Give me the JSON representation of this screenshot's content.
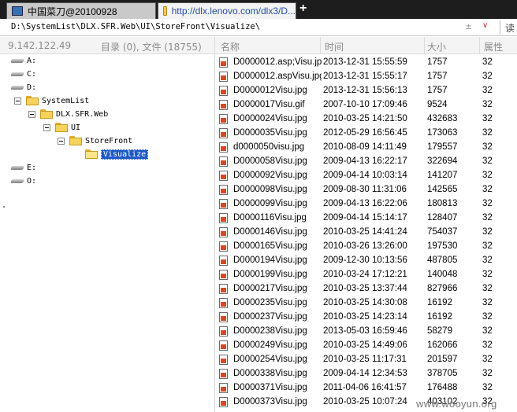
{
  "tabs": [
    {
      "label": "中国菜刀@20100928"
    },
    {
      "label": "http://dlx.lenovo.com/dlx3/D..."
    }
  ],
  "new_tab_label": "+",
  "path": {
    "value": "D:\\SystemList\\DLX.SFR.Web\\UI\\StoreFront\\Visualize\\",
    "go_label": "读",
    "up_label": "±"
  },
  "header": {
    "server_ip": "9.142.122.49",
    "summary": "目录 (0), 文件 (18755)",
    "columns": {
      "name": "名称",
      "time": "时间",
      "size": "大小",
      "attr": "属性"
    }
  },
  "tree": [
    {
      "label": "A:",
      "type": "drive"
    },
    {
      "label": "C:",
      "type": "drive"
    },
    {
      "label": "D:",
      "type": "drive"
    },
    {
      "label": "SystemList",
      "type": "folder"
    },
    {
      "label": "DLX.SFR.Web",
      "type": "folder"
    },
    {
      "label": "UI",
      "type": "folder"
    },
    {
      "label": "StoreFront",
      "type": "folder"
    },
    {
      "label": "Visualize",
      "type": "folder",
      "selected": true
    },
    {
      "label": "E:",
      "type": "drive"
    },
    {
      "label": "O:",
      "type": "drive"
    }
  ],
  "files": [
    {
      "name": "D0000012.asp;Visu.jpg",
      "time": "2013-12-31 15:55:59",
      "size": "1757",
      "attr": "32"
    },
    {
      "name": "D0000012.aspVisu.jpg",
      "time": "2013-12-31 15:55:17",
      "size": "1757",
      "attr": "32"
    },
    {
      "name": "D0000012Visu.jpg",
      "time": "2013-12-31 15:56:13",
      "size": "1757",
      "attr": "32"
    },
    {
      "name": "D0000017Visu.gif",
      "time": "2007-10-10 17:09:46",
      "size": "9524",
      "attr": "32"
    },
    {
      "name": "D0000024Visu.jpg",
      "time": "2010-03-25 14:21:50",
      "size": "432683",
      "attr": "32"
    },
    {
      "name": "D0000035Visu.jpg",
      "time": "2012-05-29 16:56:45",
      "size": "173063",
      "attr": "32"
    },
    {
      "name": "d0000050visu.jpg",
      "time": "2010-08-09 14:11:49",
      "size": "179557",
      "attr": "32"
    },
    {
      "name": "D0000058Visu.jpg",
      "time": "2009-04-13 16:22:17",
      "size": "322694",
      "attr": "32"
    },
    {
      "name": "D0000092Visu.jpg",
      "time": "2009-04-14 10:03:14",
      "size": "141207",
      "attr": "32"
    },
    {
      "name": "D0000098Visu.jpg",
      "time": "2009-08-30 11:31:06",
      "size": "142565",
      "attr": "32"
    },
    {
      "name": "D0000099Visu.jpg",
      "time": "2009-04-13 16:22:06",
      "size": "180813",
      "attr": "32"
    },
    {
      "name": "D0000116Visu.jpg",
      "time": "2009-04-14 15:14:17",
      "size": "128407",
      "attr": "32"
    },
    {
      "name": "D0000146Visu.jpg",
      "time": "2010-03-25 14:41:24",
      "size": "754037",
      "attr": "32"
    },
    {
      "name": "D0000165Visu.jpg",
      "time": "2010-03-26 13:26:00",
      "size": "197530",
      "attr": "32"
    },
    {
      "name": "D0000194Visu.jpg",
      "time": "2009-12-30 10:13:56",
      "size": "487805",
      "attr": "32"
    },
    {
      "name": "D0000199Visu.jpg",
      "time": "2010-03-24 17:12:21",
      "size": "140048",
      "attr": "32"
    },
    {
      "name": "D0000217Visu.jpg",
      "time": "2010-03-25 13:37:44",
      "size": "827966",
      "attr": "32"
    },
    {
      "name": "D0000235Visu.jpg",
      "time": "2010-03-25 14:30:08",
      "size": "16192",
      "attr": "32"
    },
    {
      "name": "D0000237Visu.jpg",
      "time": "2010-03-25 14:23:14",
      "size": "16192",
      "attr": "32"
    },
    {
      "name": "D0000238Visu.jpg",
      "time": "2013-05-03 16:59:46",
      "size": "58279",
      "attr": "32"
    },
    {
      "name": "D0000249Visu.jpg",
      "time": "2010-03-25 14:49:06",
      "size": "162066",
      "attr": "32"
    },
    {
      "name": "D0000254Visu.jpg",
      "time": "2010-03-25 11:17:31",
      "size": "201597",
      "attr": "32"
    },
    {
      "name": "D0000338Visu.jpg",
      "time": "2009-04-14 12:34:53",
      "size": "378705",
      "attr": "32"
    },
    {
      "name": "D0000371Visu.jpg",
      "time": "2011-04-06 16:41:57",
      "size": "176488",
      "attr": "32"
    },
    {
      "name": "D0000373Visu.jpg",
      "time": "2010-03-25 10:07:24",
      "size": "403102",
      "attr": "32"
    }
  ],
  "watermark": "www.wooyun.org"
}
